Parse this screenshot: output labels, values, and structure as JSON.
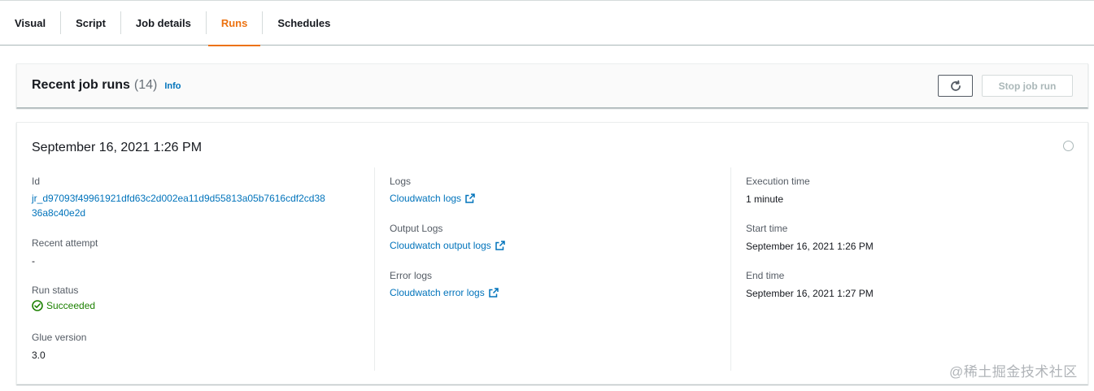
{
  "tabs": [
    {
      "label": "Visual"
    },
    {
      "label": "Script"
    },
    {
      "label": "Job details"
    },
    {
      "label": "Runs",
      "active": true
    },
    {
      "label": "Schedules"
    }
  ],
  "header": {
    "title": "Recent job runs",
    "count": "(14)",
    "info": "Info",
    "refresh_icon": "refresh-icon",
    "stop_label": "Stop job run"
  },
  "run": {
    "title": "September 16, 2021 1:26 PM",
    "id_label": "Id",
    "id_line1": "jr_d97093f49961921dfd63c2d002ea11d9d55813a05b7616cdf2cd38",
    "id_line2": "36a8c40e2d",
    "recent_attempt_label": "Recent attempt",
    "recent_attempt_value": "-",
    "run_status_label": "Run status",
    "run_status_value": "Succeeded",
    "glue_version_label": "Glue version",
    "glue_version_value": "3.0",
    "logs_label": "Logs",
    "logs_link": "Cloudwatch logs",
    "output_logs_label": "Output Logs",
    "output_logs_link": "Cloudwatch output logs",
    "error_logs_label": "Error logs",
    "error_logs_link": "Cloudwatch error logs",
    "execution_time_label": "Execution time",
    "execution_time_value": "1 minute",
    "start_time_label": "Start time",
    "start_time_value": "September 16, 2021 1:26 PM",
    "end_time_label": "End time",
    "end_time_value": "September 16, 2021 1:27 PM"
  },
  "colors": {
    "accent": "#ec7211",
    "link": "#0073bb",
    "success": "#1d8102"
  },
  "watermark": "@稀土掘金技术社区"
}
